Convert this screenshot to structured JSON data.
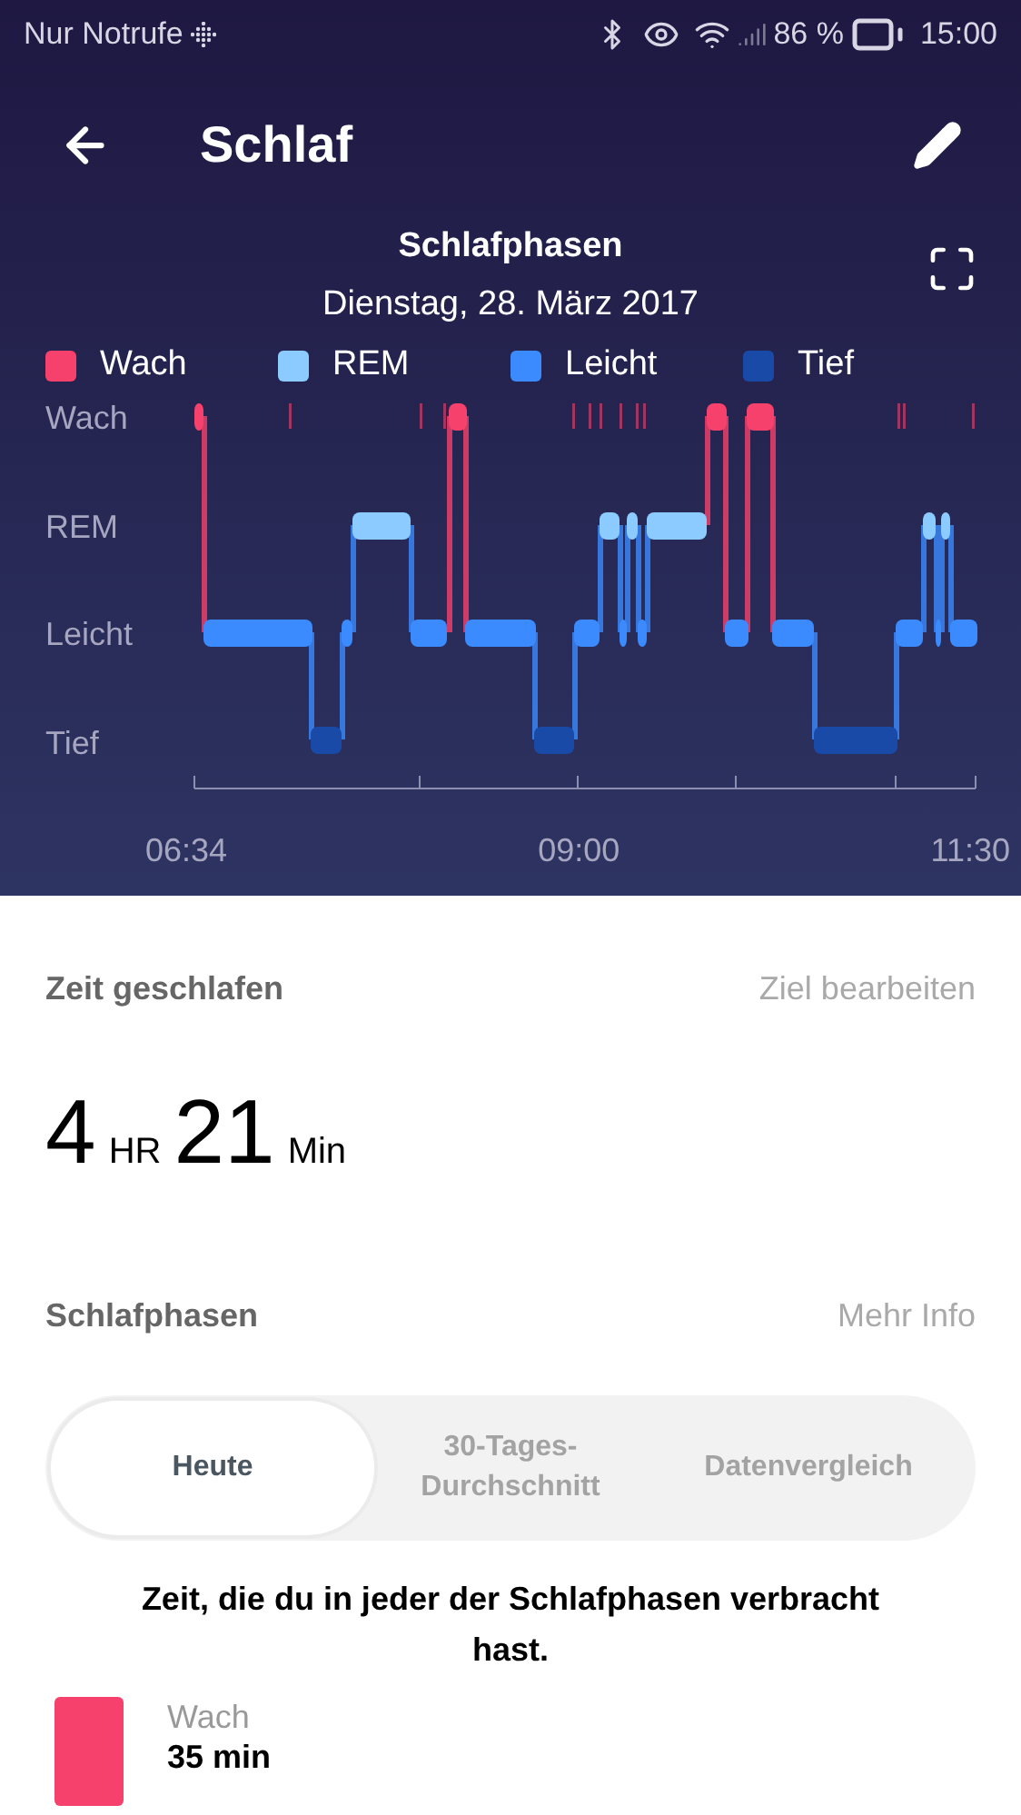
{
  "status_bar": {
    "carrier": "Nur Notrufe",
    "battery": "86 %",
    "time": "15:00"
  },
  "header": {
    "title": "Schlaf"
  },
  "chart": {
    "title": "Schlafphasen",
    "date": "Dienstag, 28. März 2017",
    "legend": [
      {
        "label": "Wach",
        "color": "#f5416c"
      },
      {
        "label": "REM",
        "color": "#8ccbff"
      },
      {
        "label": "Leicht",
        "color": "#3b8bff"
      },
      {
        "label": "Tief",
        "color": "#1a4aa8"
      }
    ],
    "y_labels": [
      "Wach",
      "REM",
      "Leicht",
      "Tief"
    ],
    "x_labels": [
      "06:34",
      "09:00",
      "11:30"
    ]
  },
  "summary": {
    "label": "Zeit geschlafen",
    "link": "Ziel bearbeiten",
    "hours": "4",
    "hours_unit": "HR",
    "minutes": "21",
    "minutes_unit": "Min"
  },
  "phases": {
    "label": "Schlafphasen",
    "link": "Mehr Info",
    "tabs": [
      {
        "label": "Heute",
        "selected": true
      },
      {
        "label": "30-Tages-Durchschnitt",
        "selected": false
      },
      {
        "label": "Datenvergleich",
        "selected": false
      }
    ],
    "description": "Zeit, die du in jeder der Schlafphasen verbracht hast.",
    "items": [
      {
        "label": "Wach",
        "value": "35 min",
        "color": "#f5416c"
      }
    ]
  }
}
